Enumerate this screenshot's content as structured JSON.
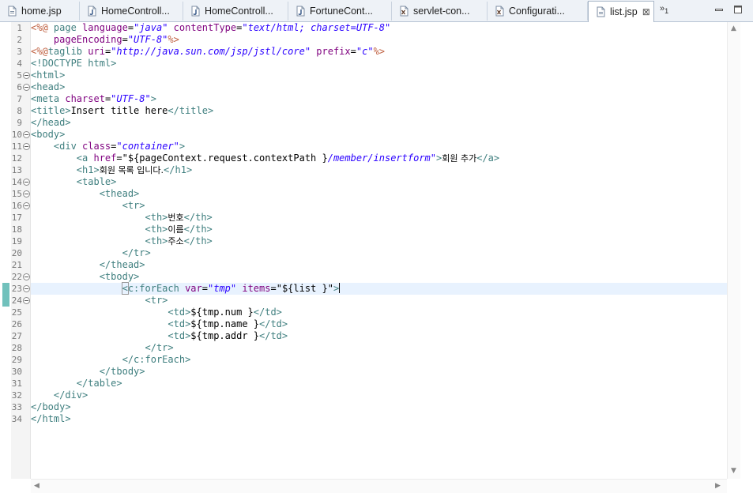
{
  "tabs": [
    {
      "label": "home.jsp",
      "icon": "jsp-file-icon"
    },
    {
      "label": "HomeControll...",
      "icon": "java-file-icon"
    },
    {
      "label": "HomeControll...",
      "icon": "java-file-icon"
    },
    {
      "label": "FortuneCont...",
      "icon": "java-file-icon"
    },
    {
      "label": "servlet-con...",
      "icon": "xml-file-icon"
    },
    {
      "label": "Configurati...",
      "icon": "xml-file-icon"
    },
    {
      "label": "list.jsp",
      "icon": "jsp-file-icon",
      "active": true
    }
  ],
  "tab_close_glyph": "⊠",
  "overflow": {
    "glyph": "»",
    "count": "1"
  },
  "current_line": 23,
  "lines": [
    {
      "n": "1"
    },
    {
      "n": "2"
    },
    {
      "n": "3"
    },
    {
      "n": "4"
    },
    {
      "n": "5"
    },
    {
      "n": "6"
    },
    {
      "n": "7"
    },
    {
      "n": "8"
    },
    {
      "n": "9"
    },
    {
      "n": "10"
    },
    {
      "n": "11"
    },
    {
      "n": "12"
    },
    {
      "n": "13"
    },
    {
      "n": "14"
    },
    {
      "n": "15"
    },
    {
      "n": "16"
    },
    {
      "n": "17"
    },
    {
      "n": "18"
    },
    {
      "n": "19"
    },
    {
      "n": "20"
    },
    {
      "n": "21"
    },
    {
      "n": "22"
    },
    {
      "n": "23"
    },
    {
      "n": "24"
    },
    {
      "n": "25"
    },
    {
      "n": "26"
    },
    {
      "n": "27"
    },
    {
      "n": "28"
    },
    {
      "n": "29"
    },
    {
      "n": "30"
    },
    {
      "n": "31"
    },
    {
      "n": "32"
    },
    {
      "n": "33"
    },
    {
      "n": "34"
    }
  ],
  "code": {
    "l1a": "<%@",
    "l1b": " page ",
    "l1c": "language",
    "l1d": "=",
    "l1e": "\"java\"",
    "l1f": " contentType",
    "l1g": "=",
    "l1h": "\"text/html; charset=UTF-8\"",
    "l2a": "    pageEncoding",
    "l2b": "=",
    "l2c": "\"UTF-8\"",
    "l2d": "%>",
    "l3a": "<%@",
    "l3b": "taglib ",
    "l3c": "uri",
    "l3d": "=",
    "l3e": "\"http://java.sun.com/jsp/jstl/core\"",
    "l3f": " prefix",
    "l3g": "=",
    "l3h": "\"c\"",
    "l3i": "%>",
    "l4": "<!DOCTYPE html>",
    "l5": "<html>",
    "l6": "<head>",
    "l7a": "<meta ",
    "l7b": "charset",
    "l7c": "=",
    "l7d": "\"UTF-8\"",
    "l7e": ">",
    "l8a": "<title>",
    "l8b": "Insert title here",
    "l8c": "</title>",
    "l9": "</head>",
    "l10": "<body>",
    "l11a": "    <div ",
    "l11b": "class",
    "l11c": "=",
    "l11d": "\"container\"",
    "l11e": ">",
    "l12a": "        <a ",
    "l12b": "href",
    "l12c": "=",
    "l12d": "\"${pageContext.request.contextPath }",
    "l12e": "/member/insertform\"",
    "l12f": ">",
    "l12g": "회원 추가",
    "l12h": "</a>",
    "l13a": "        <h1>",
    "l13b": "회원 목록 입니다.",
    "l13c": "</h1>",
    "l14": "        <table>",
    "l15": "            <thead>",
    "l16": "                <tr>",
    "l17a": "                    <th>",
    "l17b": "번호",
    "l17c": "</th>",
    "l18a": "                    <th>",
    "l18b": "이름",
    "l18c": "</th>",
    "l19a": "                    <th>",
    "l19b": "주소",
    "l19c": "</th>",
    "l20": "                </tr>",
    "l21": "            </thead>",
    "l22": "            <tbody>",
    "l23a": "                ",
    "l23b": "<",
    "l23c": "c:forEach ",
    "l23d": "var",
    "l23e": "=",
    "l23f": "\"tmp\"",
    "l23g": " items",
    "l23h": "=",
    "l23i": "\"${list }\"",
    "l23j": ">",
    "l24": "                    <tr>",
    "l25a": "                        <td>",
    "l25b": "${tmp.num }",
    "l25c": "</td>",
    "l26a": "                        <td>",
    "l26b": "${tmp.name }",
    "l26c": "</td>",
    "l27a": "                        <td>",
    "l27b": "${tmp.addr }",
    "l27c": "</td>",
    "l28": "                    </tr>",
    "l29": "                </c:forEach>",
    "l30": "            </tbody>",
    "l31": "        </table>",
    "l32": "    </div>",
    "l33": "</body>",
    "l34": "</html>"
  },
  "colors": {
    "tag": "#3f7f7f",
    "attribute": "#7f007f",
    "string": "#2a00ff",
    "directive": "#bf5f3f",
    "current_line": "#e8f2fe",
    "marker": "#58b6b0"
  }
}
